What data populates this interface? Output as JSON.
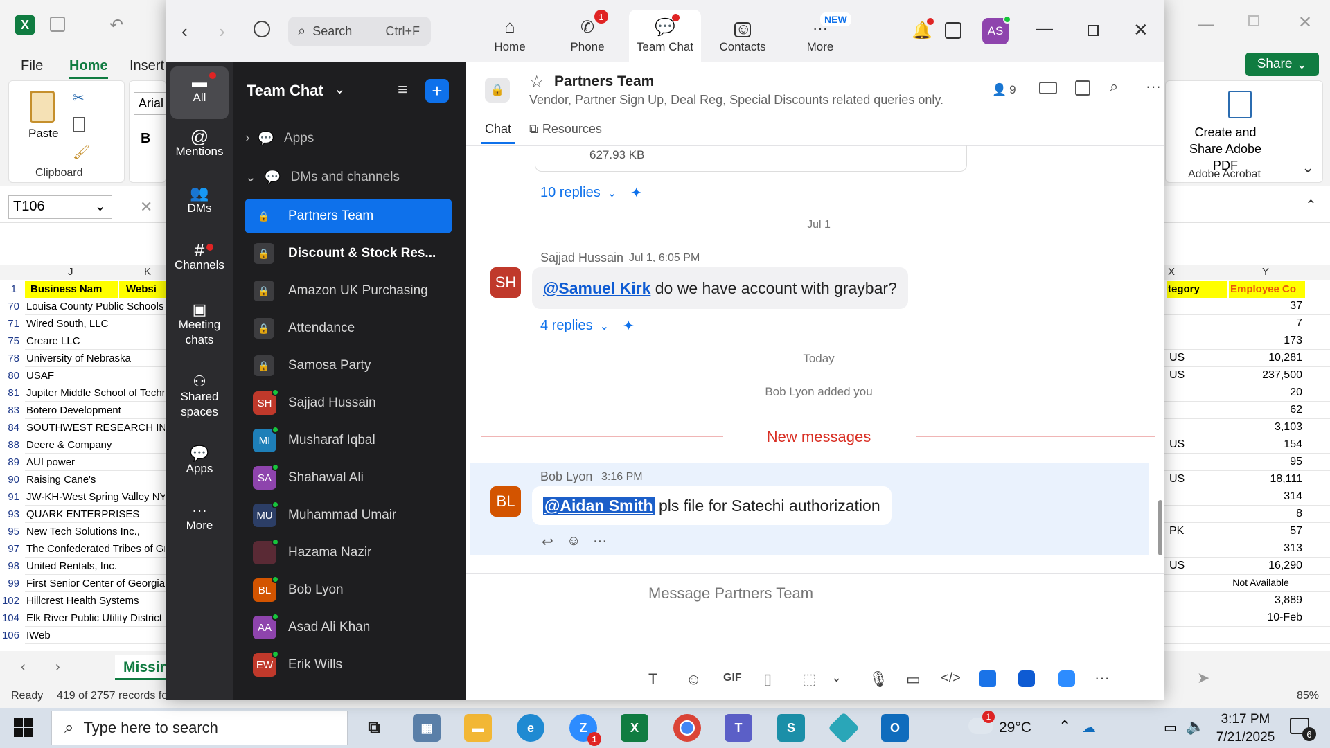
{
  "excel": {
    "menu": [
      "File",
      "Home",
      "Insert"
    ],
    "active_menu": "Home",
    "clipboard_label": "Clipboard",
    "paste_label": "Paste",
    "font_name": "Arial",
    "bold_label": "B",
    "name_box": "T106",
    "share_label": "Share",
    "acrobat_label": "Create and Share Adobe PDF",
    "acrobat_group": "Adobe Acrobat",
    "columns": {
      "j": "J",
      "k": "K",
      "x": "X",
      "y": "Y"
    },
    "header_row": {
      "row": "1",
      "business": "Business Nam",
      "website": "Websi",
      "category": "tegory",
      "employee": "Employee Co"
    },
    "rows": [
      {
        "n": "70",
        "name": "Louisa County Public Schools",
        "country": "",
        "count": "37"
      },
      {
        "n": "71",
        "name": "Wired South, LLC",
        "country": "",
        "count": "7"
      },
      {
        "n": "75",
        "name": "Creare LLC",
        "country": "",
        "count": "173"
      },
      {
        "n": "78",
        "name": "University of Nebraska",
        "country": "US",
        "count": "10,281"
      },
      {
        "n": "80",
        "name": "USAF",
        "country": "US",
        "count": "237,500"
      },
      {
        "n": "81",
        "name": "Jupiter Middle School of Techno",
        "country": "",
        "count": "20"
      },
      {
        "n": "83",
        "name": "Botero Development",
        "country": "",
        "count": "62"
      },
      {
        "n": "84",
        "name": "SOUTHWEST RESEARCH INS",
        "country": "",
        "count": "3,103"
      },
      {
        "n": "88",
        "name": "Deere & Company",
        "country": "US",
        "count": "154"
      },
      {
        "n": "89",
        "name": "AUI power",
        "country": "",
        "count": "95"
      },
      {
        "n": "90",
        "name": "Raising Cane's",
        "country": "US",
        "count": "18,111"
      },
      {
        "n": "91",
        "name": "JW-KH-West Spring Valley NY",
        "country": "",
        "count": "314"
      },
      {
        "n": "93",
        "name": "QUARK ENTERPRISES",
        "country": "",
        "count": "8"
      },
      {
        "n": "95",
        "name": "New Tech Solutions Inc.,",
        "country": "PK",
        "count": "57"
      },
      {
        "n": "97",
        "name": "The Confederated Tribes of Gra",
        "country": "",
        "count": "313"
      },
      {
        "n": "98",
        "name": "United Rentals, Inc.",
        "country": "US",
        "count": "16,290"
      },
      {
        "n": "99",
        "name": "First Senior Center of Georgia I",
        "country": "",
        "count": "Not Available"
      },
      {
        "n": "102",
        "name": "Hillcrest Health Systems",
        "country": "",
        "count": "3,889"
      },
      {
        "n": "104",
        "name": "Elk River Public Utility District",
        "country": "",
        "count": "10-Feb"
      },
      {
        "n": "106",
        "name": "IWeb",
        "country": "",
        "count": ""
      }
    ],
    "sheet_tab": "Missin",
    "status_ready": "Ready",
    "status_records": "419 of 2757 records fo",
    "zoom_level": "85%"
  },
  "zoom": {
    "search_placeholder": "Search",
    "search_shortcut": "Ctrl+F",
    "nav": [
      {
        "label": "Home",
        "badge": ""
      },
      {
        "label": "Phone",
        "badge": "1"
      },
      {
        "label": "Team Chat",
        "badge": ""
      },
      {
        "label": "Contacts",
        "badge": ""
      },
      {
        "label": "More",
        "badge": "NEW"
      }
    ],
    "profile_initials": "AS",
    "rail": [
      {
        "label": "All"
      },
      {
        "label": "Mentions"
      },
      {
        "label": "DMs"
      },
      {
        "label": "Channels"
      },
      {
        "label": "Meeting chats"
      },
      {
        "label": "Shared spaces"
      },
      {
        "label": "Apps"
      },
      {
        "label": "More"
      }
    ],
    "sidebar": {
      "title": "Team Chat",
      "apps_label": "Apps",
      "dms_label": "DMs and channels",
      "items": [
        {
          "label": "Partners Team",
          "type": "lock",
          "initials": "",
          "color": ""
        },
        {
          "label": "Discount & Stock Res...",
          "type": "lock",
          "initials": "",
          "color": ""
        },
        {
          "label": "Amazon UK Purchasing",
          "type": "lock",
          "initials": "",
          "color": ""
        },
        {
          "label": "Attendance",
          "type": "lock",
          "initials": "",
          "color": ""
        },
        {
          "label": "Samosa Party",
          "type": "lock",
          "initials": "",
          "color": ""
        },
        {
          "label": "Sajjad Hussain",
          "type": "avatar",
          "initials": "SH",
          "color": "#c0392b"
        },
        {
          "label": "Musharaf Iqbal",
          "type": "avatar",
          "initials": "MI",
          "color": "#1e7fb8"
        },
        {
          "label": "Shahawal Ali",
          "type": "avatar",
          "initials": "SA",
          "color": "#8e44ad"
        },
        {
          "label": "Muhammad Umair",
          "type": "avatar",
          "initials": "MU",
          "color": "#2c3e66"
        },
        {
          "label": "Hazama Nazir",
          "type": "avatar",
          "initials": "",
          "color": "#5a2a35"
        },
        {
          "label": "Bob Lyon",
          "type": "avatar",
          "initials": "BL",
          "color": "#d35400"
        },
        {
          "label": "Asad Ali Khan",
          "type": "avatar",
          "initials": "AA",
          "color": "#8e44ad"
        },
        {
          "label": "Erik Wills",
          "type": "avatar",
          "initials": "EW",
          "color": "#c0392b"
        }
      ]
    },
    "channel": {
      "name": "Partners Team",
      "description": "Vendor, Partner Sign Up, Deal Reg, Special Discounts related queries only.",
      "members": "9",
      "tabs": [
        "Chat",
        "Resources"
      ]
    },
    "messages": {
      "file_size": "627.93 KB",
      "replies1": "10 replies",
      "date1": "Jul 1",
      "msg1_sender": "Sajjad Hussain",
      "msg1_time": "Jul 1, 6:05 PM",
      "msg1_initials": "SH",
      "msg1_mention": "@Samuel Kirk",
      "msg1_text": " do we have account with graybar?",
      "replies2": "4 replies",
      "date2": "Today",
      "system_msg": "Bob Lyon added you",
      "new_messages": "New messages",
      "msg2_sender": "Bob Lyon",
      "msg2_time": "3:16 PM",
      "msg2_initials": "BL",
      "msg2_mention": "@Aidan Smith",
      "msg2_text": " pls file for Satechi authorization"
    },
    "composer_placeholder": "Message Partners Team"
  },
  "taskbar": {
    "search_placeholder": "Type here to search",
    "weather": "29°C",
    "time": "3:17 PM",
    "date": "7/21/2025",
    "notifications": "6",
    "weather_badge": "1",
    "zoom_badge": "1"
  }
}
